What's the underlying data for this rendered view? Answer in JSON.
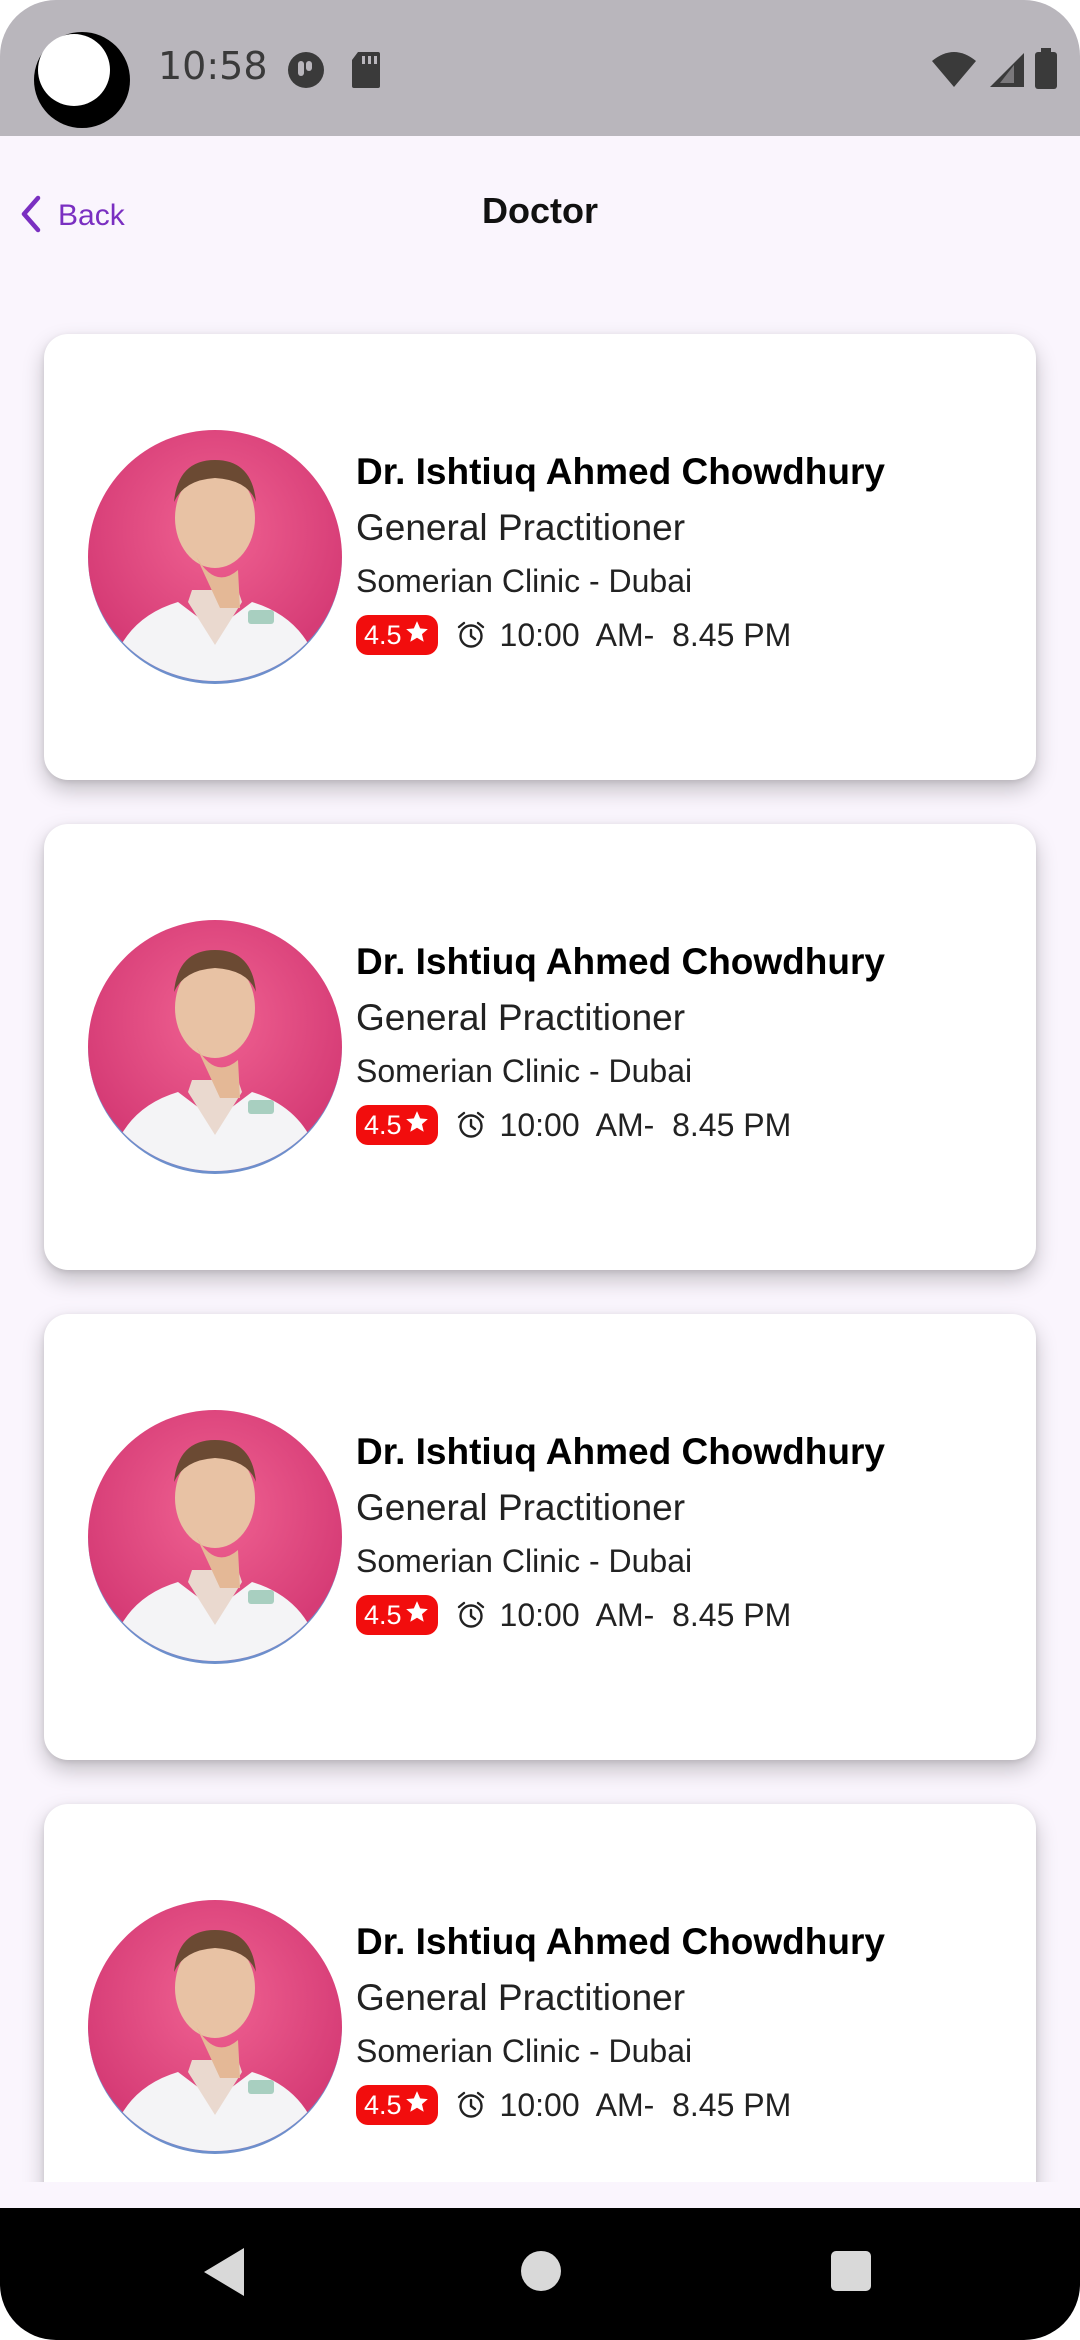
{
  "status_bar": {
    "time": "10:58"
  },
  "app_bar": {
    "back_label": "Back",
    "title": "Doctor"
  },
  "colors": {
    "accent": "#7a2fc1",
    "rating_badge": "#f20d0d",
    "avatar_bg": "#e05285"
  },
  "doctors": [
    {
      "name": "Dr. Ishtiuq Ahmed Chowdhury",
      "specialty": "General Practitioner",
      "clinic": "Somerian Clinic - Dubai",
      "rating": "4.5",
      "hours": "10:00  AM-  8.45 PM"
    },
    {
      "name": "Dr. Ishtiuq Ahmed Chowdhury",
      "specialty": "General Practitioner",
      "clinic": "Somerian Clinic - Dubai",
      "rating": "4.5",
      "hours": "10:00  AM-  8.45 PM"
    },
    {
      "name": "Dr. Ishtiuq Ahmed Chowdhury",
      "specialty": "General Practitioner",
      "clinic": "Somerian Clinic - Dubai",
      "rating": "4.5",
      "hours": "10:00  AM-  8.45 PM"
    },
    {
      "name": "Dr. Ishtiuq Ahmed Chowdhury",
      "specialty": "General Practitioner",
      "clinic": "Somerian Clinic - Dubai",
      "rating": "4.5",
      "hours": "10:00  AM-  8.45 PM"
    }
  ],
  "icons": {
    "back": "chevron-left-icon",
    "rating": "star-icon",
    "time": "alarm-clock-icon",
    "nav_back": "triangle-back-icon",
    "nav_home": "circle-home-icon",
    "nav_recents": "square-recents-icon"
  }
}
